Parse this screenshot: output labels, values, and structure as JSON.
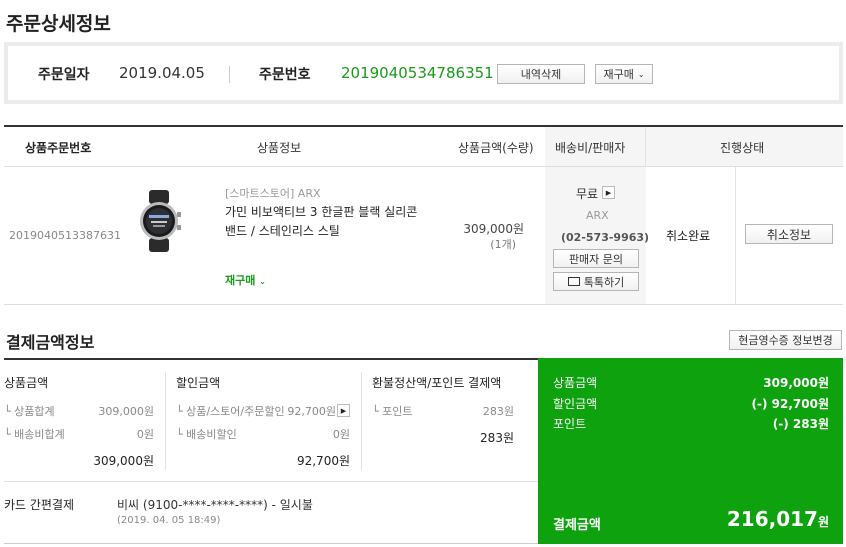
{
  "page_title": "주문상세정보",
  "order": {
    "date_label": "주문일자",
    "date_value": "2019.04.05",
    "number_label": "주문번호",
    "number_value": "2019040534786351",
    "delete_button": "내역삭제",
    "reorder_button": "재구매"
  },
  "table": {
    "headers": {
      "product_order_no": "상품주문번호",
      "product_info": "상품정보",
      "price_qty": "상품금액(수량)",
      "shipping_seller": "배송비/판매자",
      "status": "진행상태"
    },
    "row": {
      "product_order_no": "2019040513387631",
      "store": "[스마트스토어] ARX",
      "product_name_line1": "가민 비보액티브 3 한글판 블랙 실리콘",
      "product_name_line2": "밴드 / 스테인리스 스틸",
      "reorder_link": "재구매",
      "price": "309,000원",
      "qty": "(1개)",
      "shipping_fee": "무료",
      "seller": "ARX",
      "seller_phone": "(02-573-9963)",
      "seller_inquiry_button": "판매자 문의",
      "talktalk_button": "톡톡하기",
      "status": "취소완료",
      "cancel_info_button": "취소정보"
    }
  },
  "payment": {
    "section_title": "결제금액정보",
    "receipt_button": "현금영수증 정보변경",
    "product_amount": {
      "title": "상품금액",
      "items": [
        {
          "label": "상품합계",
          "value": "309,000원"
        },
        {
          "label": "배송비합계",
          "value": "0원"
        }
      ],
      "total": "309,000원"
    },
    "discount": {
      "title": "할인금액",
      "items": [
        {
          "label": "상품/스토어/주문할인",
          "value": "92,700원"
        },
        {
          "label": "배송비할인",
          "value": "0원"
        }
      ],
      "total": "92,700원"
    },
    "refund": {
      "title": "환불정산액/포인트 결제액",
      "items": [
        {
          "label": "포인트",
          "value": "283원"
        }
      ],
      "total": "283원"
    },
    "summary": {
      "items": [
        {
          "label": "상품금액",
          "value": "309,000원"
        },
        {
          "label": "할인금액",
          "value": "(-) 92,700원"
        },
        {
          "label": "포인트",
          "value": "(-) 283원"
        }
      ],
      "total_label": "결제금액",
      "total_value": "216,017",
      "total_unit": "원"
    },
    "method": {
      "label": "카드 간편결제",
      "detail": "비씨 (9100-****-****-****) - 일시불",
      "datetime": "(2019. 04. 05 18:49)"
    }
  },
  "colors": {
    "accent_green": "#1a9a1a",
    "summary_bg": "#0ea20e"
  }
}
